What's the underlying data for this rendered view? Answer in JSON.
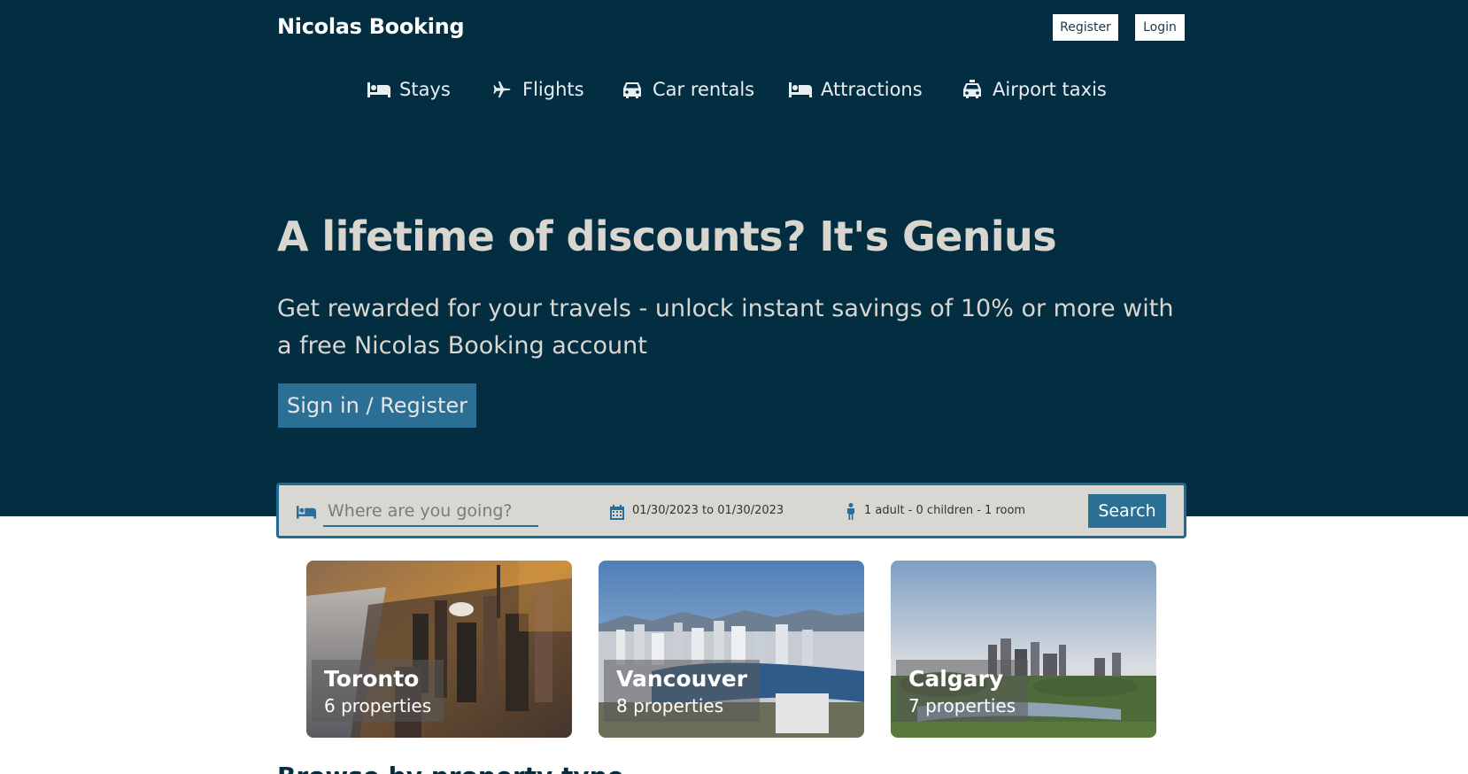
{
  "header": {
    "brand": "Nicolas Booking",
    "register_label": "Register",
    "login_label": "Login"
  },
  "nav": {
    "items": [
      {
        "label": "Stays",
        "icon": "bed-icon"
      },
      {
        "label": "Flights",
        "icon": "plane-icon"
      },
      {
        "label": "Car rentals",
        "icon": "car-icon"
      },
      {
        "label": "Attractions",
        "icon": "bed-icon"
      },
      {
        "label": "Airport taxis",
        "icon": "taxi-icon"
      }
    ]
  },
  "hero": {
    "title": "A lifetime of discounts? It's Genius",
    "subtitle": "Get rewarded for your travels - unlock instant savings of 10% or more with a free Nicolas Booking account",
    "cta_label": "Sign in / Register"
  },
  "search": {
    "destination_placeholder": "Where are you going?",
    "destination_value": "",
    "dates": "01/30/2023 to 01/30/2023",
    "guests": "1 adult - 0 children - 1 room",
    "button_label": "Search"
  },
  "featured": {
    "cities": [
      {
        "name": "Toronto",
        "properties": "6 properties"
      },
      {
        "name": "Vancouver",
        "properties": "8 properties"
      },
      {
        "name": "Calgary",
        "properties": "7 properties"
      }
    ]
  },
  "browse": {
    "heading": "Browse by property type"
  },
  "colors": {
    "hero_bg": "#032e42",
    "accent": "#2c6f94",
    "search_bg": "#d9d7d2",
    "headline_text": "#d9d6d0"
  }
}
